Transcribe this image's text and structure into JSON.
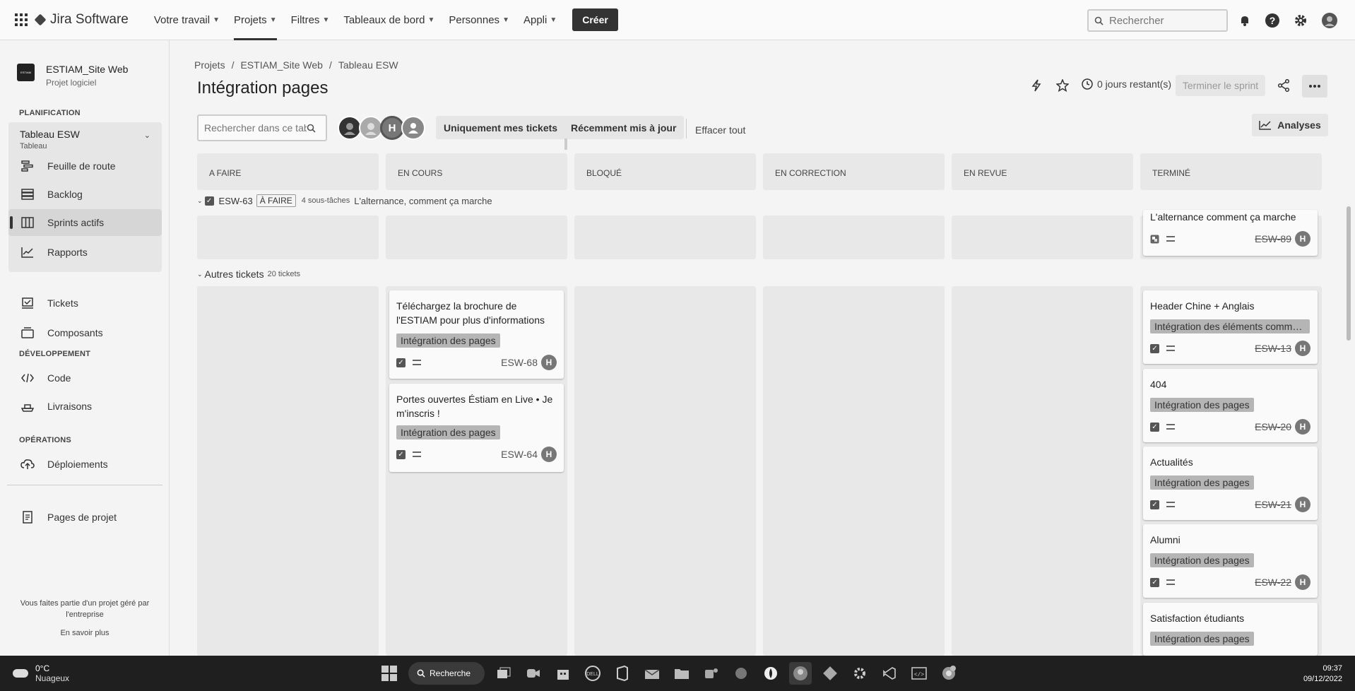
{
  "topnav": {
    "product": "Jira Software",
    "items": [
      {
        "label": "Votre travail"
      },
      {
        "label": "Projets"
      },
      {
        "label": "Filtres"
      },
      {
        "label": "Tableaux de bord"
      },
      {
        "label": "Personnes"
      },
      {
        "label": "Appli"
      }
    ],
    "create_label": "Créer",
    "search_placeholder": "Rechercher"
  },
  "sidebar": {
    "project_name": "ESTIAM_Site Web",
    "project_type": "Projet logiciel",
    "section_planning": "PLANIFICATION",
    "board_name": "Tableau ESW",
    "board_type": "Tableau",
    "planning_items": [
      {
        "label": "Feuille de route",
        "icon": "roadmap-icon"
      },
      {
        "label": "Backlog",
        "icon": "backlog-icon"
      },
      {
        "label": "Sprints actifs",
        "icon": "board-icon"
      },
      {
        "label": "Rapports",
        "icon": "reports-icon"
      }
    ],
    "items_other": [
      {
        "label": "Tickets",
        "icon": "tickets-icon"
      },
      {
        "label": "Composants",
        "icon": "components-icon"
      }
    ],
    "section_dev": "DÉVELOPPEMENT",
    "dev_items": [
      {
        "label": "Code",
        "icon": "code-icon"
      },
      {
        "label": "Livraisons",
        "icon": "releases-icon"
      }
    ],
    "section_ops": "OPÉRATIONS",
    "ops_items": [
      {
        "label": "Déploiements",
        "icon": "deployments-icon"
      }
    ],
    "project_pages": "Pages de projet",
    "footer_text": "Vous faites partie d'un projet géré par l'entreprise",
    "footer_link": "En savoir plus"
  },
  "main": {
    "breadcrumb": [
      "Projets",
      "ESTIAM_Site Web",
      "Tableau ESW"
    ],
    "title": "Intégration pages",
    "days_remaining": "0 jours restant(s)",
    "finish_sprint": "Terminer le sprint",
    "board_search_placeholder": "Rechercher dans ce tab",
    "filter_mine": "Uniquement mes tickets",
    "filter_recent": "Récemment mis à jour",
    "clear_all": "Effacer tout",
    "analyses": "Analyses",
    "columns": [
      "A FAIRE",
      "EN COURS",
      "BLOQUÉ",
      "EN CORRECTION",
      "EN REVUE",
      "TERMINÉ"
    ],
    "swimlane1": {
      "key": "ESW-63",
      "status": "À FAIRE",
      "subtasks": "4 sous-tâches",
      "summary": "L'alternance, comment ça marche",
      "done_card": {
        "title": "L'alternance comment ça marche",
        "key": "ESW-89"
      }
    },
    "swimlane2": {
      "title": "Autres tickets",
      "count": "20 tickets"
    },
    "in_progress_cards": [
      {
        "title": "Téléchargez la brochure de l'ESTIAM pour plus d'informations",
        "label": "Intégration des pages",
        "key": "ESW-68"
      },
      {
        "title": "Portes ouvertes Éstiam en Live • Je m'inscris !",
        "label": "Intégration des pages",
        "key": "ESW-64"
      }
    ],
    "done_cards": [
      {
        "title": "Header Chine + Anglais",
        "label": "Intégration des éléments commu...",
        "key": "ESW-13"
      },
      {
        "title": "404",
        "label": "Intégration des pages",
        "key": "ESW-20"
      },
      {
        "title": "Actualités",
        "label": "Intégration des pages",
        "key": "ESW-21"
      },
      {
        "title": "Alumni",
        "label": "Intégration des pages",
        "key": "ESW-22"
      },
      {
        "title": "Satisfaction étudiants",
        "label": "Intégration des pages",
        "key": ""
      }
    ]
  },
  "taskbar": {
    "temp": "0°C",
    "weather": "Nuageux",
    "search": "Recherche",
    "time": "09:37",
    "date": "09/12/2022"
  }
}
